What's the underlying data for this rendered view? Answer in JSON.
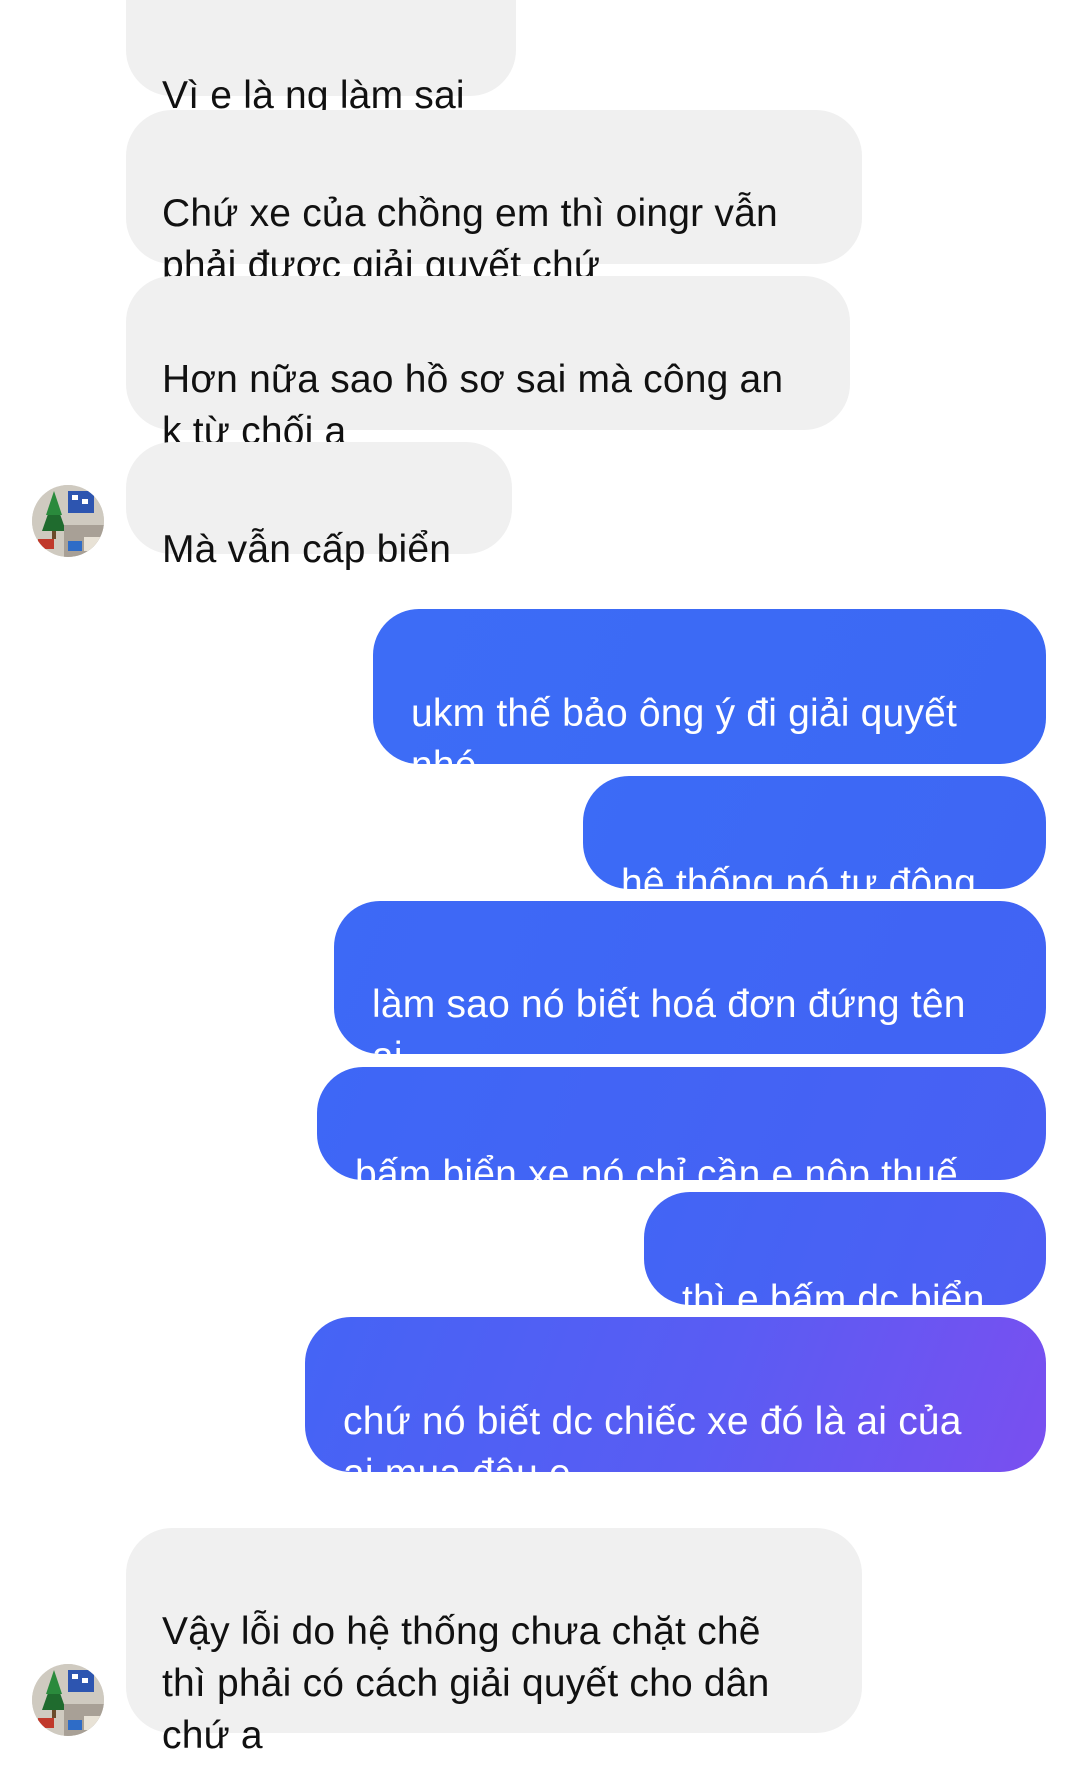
{
  "messages": [
    {
      "side": "incoming",
      "text": "Vì e là ng làm sai"
    },
    {
      "side": "incoming",
      "text": "Chứ xe của chồng em thì oingr vẫn\nphải được giải quyết chứ"
    },
    {
      "side": "incoming",
      "text": "Hơn nữa sao hồ sơ sai mà công an\nk từ chối ạ"
    },
    {
      "side": "incoming",
      "text": "Mà vẫn cấp biển"
    },
    {
      "side": "outgoing",
      "text": "ukm thế bảo ông ý đi giải quyết\nnhé"
    },
    {
      "side": "outgoing",
      "text": "hệ thống nó tự động"
    },
    {
      "side": "outgoing",
      "text": "làm sao nó biết hoá đơn đứng tên\nai"
    },
    {
      "side": "outgoing",
      "text": "bấm biển xe nó chỉ cần e nộp thuế"
    },
    {
      "side": "outgoing",
      "text": "thì e bấm dc biển"
    },
    {
      "side": "outgoing",
      "text": "chứ nó biết dc chiếc xe đó là ai của\nai mua đâu e"
    },
    {
      "side": "incoming",
      "text": "Vậy lỗi do hệ thống chưa chặt chẽ\nthì phải có cách giải quyết cho dân\nchứ a"
    }
  ],
  "colors": {
    "incoming_bubble": "#f0f0f0",
    "outgoing_bubble_start": "#3b6cf6",
    "outgoing_bubble_end": "#7a4ff0",
    "background": "#ffffff"
  },
  "icons": {
    "avatar": "contact-avatar-christmas-tree"
  }
}
